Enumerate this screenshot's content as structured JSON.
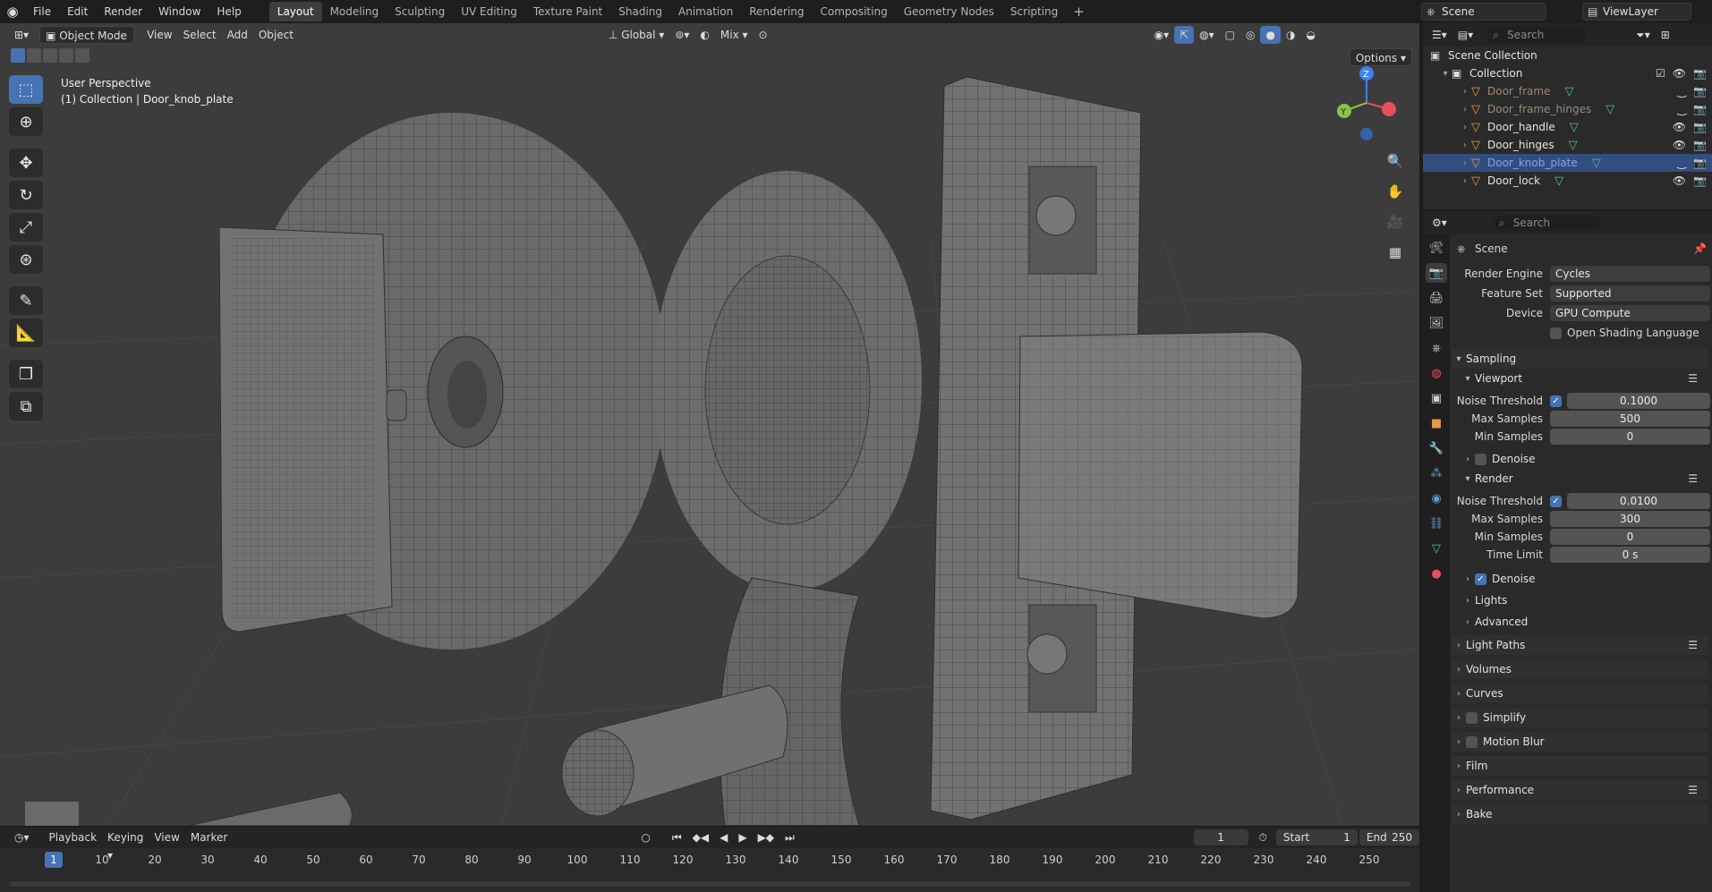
{
  "menubar": {
    "items": [
      "File",
      "Edit",
      "Render",
      "Window",
      "Help"
    ],
    "workspaces": [
      "Layout",
      "Modeling",
      "Sculpting",
      "UV Editing",
      "Texture Paint",
      "Shading",
      "Animation",
      "Rendering",
      "Compositing",
      "Geometry Nodes",
      "Scripting"
    ],
    "active_workspace": "Layout",
    "scene_name": "Scene",
    "view_layer": "ViewLayer"
  },
  "viewport_header": {
    "mode": "Object Mode",
    "menus": [
      "View",
      "Select",
      "Add",
      "Object"
    ],
    "orientation": "Global",
    "snap_mode": "Mix",
    "options_label": "Options"
  },
  "viewport": {
    "perspective_label": "User Perspective",
    "collection_label": "(1) Collection | Door_knob_plate",
    "gizmo_axes": [
      "X",
      "Y",
      "Z"
    ],
    "colors": {
      "background": "#3c3c3c",
      "mesh": "#6e6e6e",
      "wire": "#2a2a2a",
      "grid": "#454545",
      "axis_x": "#e94e5c",
      "axis_y": "#8bc34a",
      "axis_z": "#3b82f6"
    }
  },
  "toolbar": {
    "tools": [
      "select-box-icon",
      "cursor-icon",
      "move-icon",
      "rotate-icon",
      "scale-icon",
      "transform-icon",
      "annotate-icon",
      "measure-icon",
      "add-cube-icon",
      "extrude-icon"
    ],
    "active_tool": "select-box-icon"
  },
  "timeline": {
    "menus": [
      "Playback",
      "Keying",
      "View",
      "Marker"
    ],
    "current_frame": "1",
    "start_label": "Start",
    "start_value": "1",
    "end_label": "End",
    "end_value": "250",
    "ticks": [
      "10",
      "20",
      "30",
      "40",
      "50",
      "60",
      "70",
      "80",
      "90",
      "100",
      "110",
      "120",
      "130",
      "140",
      "150",
      "160",
      "170",
      "180",
      "190",
      "200",
      "210",
      "220",
      "230",
      "240",
      "250"
    ],
    "playhead_label": "1"
  },
  "outliner": {
    "search_placeholder": "Search",
    "root": "Scene Collection",
    "collection": "Collection",
    "objects": [
      {
        "name": "Door_frame",
        "visible": false,
        "selected": false
      },
      {
        "name": "Door_frame_hinges",
        "visible": false,
        "selected": false
      },
      {
        "name": "Door_handle",
        "visible": true,
        "selected": false
      },
      {
        "name": "Door_hinges",
        "visible": true,
        "selected": false
      },
      {
        "name": "Door_knob_plate",
        "visible": false,
        "selected": true
      },
      {
        "name": "Door_lock",
        "visible": true,
        "selected": false
      }
    ]
  },
  "properties": {
    "search_placeholder": "Search",
    "context": "Scene",
    "render_engine_label": "Render Engine",
    "render_engine": "Cycles",
    "feature_set_label": "Feature Set",
    "feature_set": "Supported",
    "device_label": "Device",
    "device": "GPU Compute",
    "osl_label": "Open Shading Language",
    "sampling_label": "Sampling",
    "viewport_label": "Viewport",
    "vp_noise_label": "Noise Threshold",
    "vp_noise": "0.1000",
    "vp_max_label": "Max Samples",
    "vp_max": "500",
    "vp_min_label": "Min Samples",
    "vp_min": "0",
    "vp_denoise_label": "Denoise",
    "render_label": "Render",
    "r_noise_label": "Noise Threshold",
    "r_noise": "0.0100",
    "r_max_label": "Max Samples",
    "r_max": "300",
    "r_min_label": "Min Samples",
    "r_min": "0",
    "r_time_label": "Time Limit",
    "r_time": "0 s",
    "r_denoise_label": "Denoise",
    "lights_label": "Lights",
    "advanced_label": "Advanced",
    "sections": [
      "Light Paths",
      "Volumes",
      "Curves",
      "Simplify",
      "Motion Blur",
      "Film",
      "Performance",
      "Bake"
    ]
  }
}
